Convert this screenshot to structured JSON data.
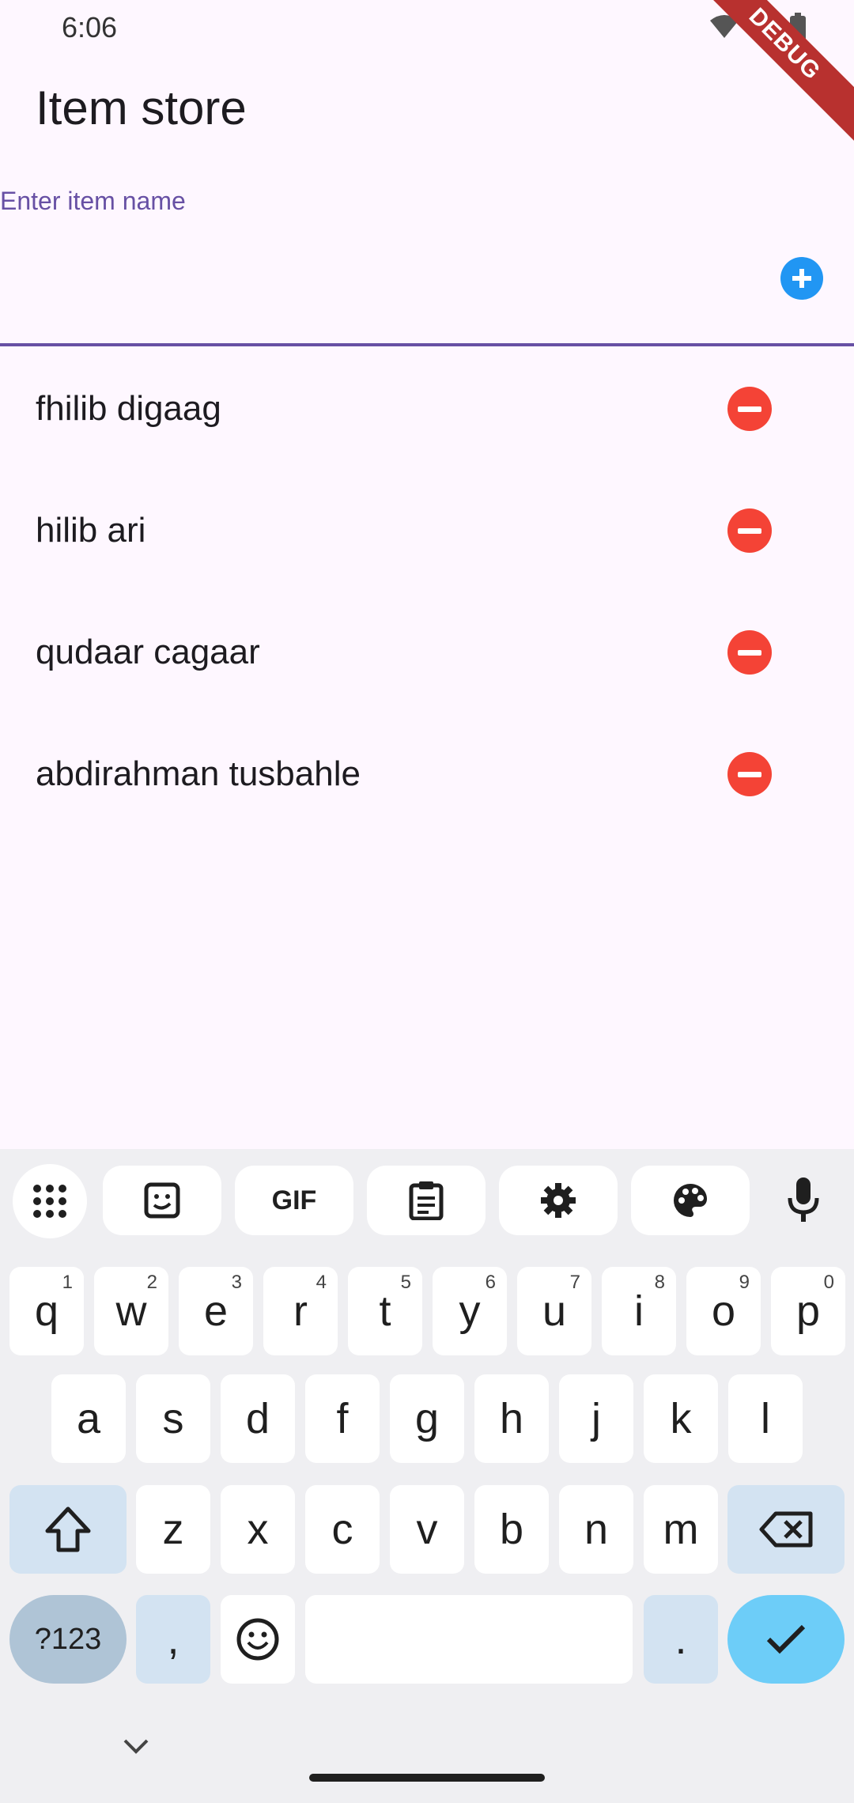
{
  "status_bar": {
    "time": "6:06"
  },
  "debug_banner": "DEBUG",
  "app_bar": {
    "title": "Item store"
  },
  "input": {
    "label": "Enter item name",
    "value": ""
  },
  "items": [
    {
      "name": "fhilib digaag"
    },
    {
      "name": "hilib ari"
    },
    {
      "name": "qudaar cagaar"
    },
    {
      "name": "abdirahman tusbahle"
    }
  ],
  "colors": {
    "accent": "#6750A4",
    "add": "#2196F3",
    "remove": "#F44336",
    "background": "#FEF7FF"
  },
  "keyboard": {
    "toolbar": [
      "apps-grid-icon",
      "sticker-icon",
      "GIF",
      "clipboard-icon",
      "settings-icon",
      "palette-icon",
      "mic-icon"
    ],
    "row1": [
      {
        "key": "q",
        "hint": "1"
      },
      {
        "key": "w",
        "hint": "2"
      },
      {
        "key": "e",
        "hint": "3"
      },
      {
        "key": "r",
        "hint": "4"
      },
      {
        "key": "t",
        "hint": "5"
      },
      {
        "key": "y",
        "hint": "6"
      },
      {
        "key": "u",
        "hint": "7"
      },
      {
        "key": "i",
        "hint": "8"
      },
      {
        "key": "o",
        "hint": "9"
      },
      {
        "key": "p",
        "hint": "0"
      }
    ],
    "row2": [
      "a",
      "s",
      "d",
      "f",
      "g",
      "h",
      "j",
      "k",
      "l"
    ],
    "row3": [
      "z",
      "x",
      "c",
      "v",
      "b",
      "n",
      "m"
    ],
    "symbols_label": "?123",
    "comma": ",",
    "period": "."
  }
}
